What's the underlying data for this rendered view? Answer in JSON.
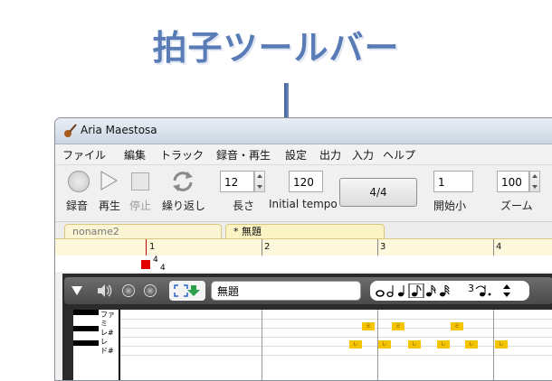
{
  "headline": "拍子ツールバー",
  "window": {
    "title": "Aria Maestosa",
    "menu": [
      "ファイル",
      "編集",
      "トラック",
      "録音・再生",
      "設定",
      "出力",
      "入力",
      "ヘルプ"
    ],
    "toolbar": {
      "record": "録音",
      "play": "再生",
      "stop": "停止",
      "loop": "繰り返し",
      "length_value": "12",
      "length_label": "長さ",
      "tempo_value": "120",
      "tempo_label": "Initial tempo",
      "time_sig_button": "4/4",
      "start_value": "1",
      "start_label": "開始小",
      "zoom_value": "100",
      "zoom_label": "ズーム"
    },
    "tabs": [
      "noname2",
      "* 無題"
    ],
    "ruler_numbers": [
      "1",
      "2",
      "3",
      "4"
    ],
    "time_signature": {
      "top": "4",
      "bottom": "4"
    },
    "track": {
      "name": "無題",
      "triplet": "3"
    },
    "piano_keys": [
      "ファ",
      "ミ",
      "レ#",
      "レ",
      "ド#"
    ],
    "note_labels": [
      "ミ",
      "レ"
    ]
  }
}
